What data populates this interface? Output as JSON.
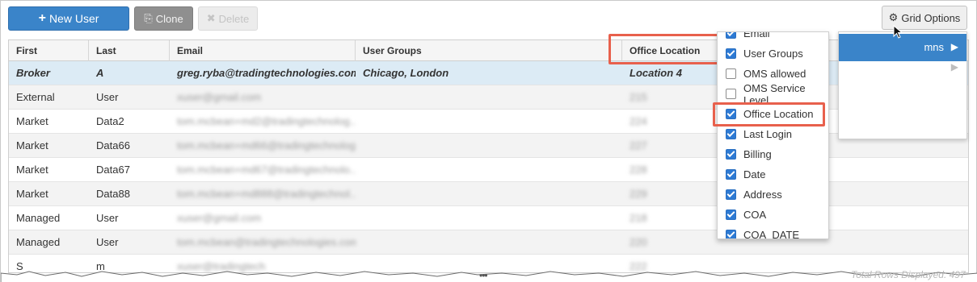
{
  "toolbar": {
    "new_user_icon": "+",
    "new_user_label": "New User",
    "clone_icon": "⎘",
    "clone_label": "Clone",
    "delete_icon": "✖",
    "delete_label": "Delete",
    "grid_options_icon": "⚙",
    "grid_options_label": "Grid Options"
  },
  "grid": {
    "columns": [
      "First",
      "Last",
      "Email",
      "User Groups",
      "Office Location"
    ],
    "rows": [
      {
        "first": "Broker",
        "last": "A",
        "email": "greg.ryba@tradingtechnologies.com",
        "groups": "Chicago, London",
        "location": "Location 4",
        "selected": true
      },
      {
        "first": "External",
        "last": "User",
        "email": "xuser@gmail.com",
        "groups": "",
        "location": "215"
      },
      {
        "first": "Market",
        "last": "Data2",
        "email": "tom.mcbean+md2@tradingtechnolog...",
        "groups": "",
        "location": "224"
      },
      {
        "first": "Market",
        "last": "Data66",
        "email": "tom.mcbean+md66@tradingtechnolog...",
        "groups": "",
        "location": "227"
      },
      {
        "first": "Market",
        "last": "Data67",
        "email": "tom.mcbean+md67@tradingtechnolo...",
        "groups": "",
        "location": "228"
      },
      {
        "first": "Market",
        "last": "Data88",
        "email": "tom.mcbean+md888@tradingtechnol...",
        "groups": "",
        "location": "229"
      },
      {
        "first": "Managed",
        "last": "User",
        "email": "xuser@gmail.com",
        "groups": "",
        "location": "218"
      },
      {
        "first": "Managed",
        "last": "User",
        "email": "tom.mcbean@tradingtechnologies.com",
        "groups": "",
        "location": "220"
      },
      {
        "first": "S",
        "last": "m",
        "email": "xuser@tradingtech",
        "groups": "",
        "location": "222"
      }
    ]
  },
  "menu": {
    "columns_label": "mns",
    "arrow": "▶"
  },
  "columns_menu": {
    "options": [
      {
        "label": "Email",
        "checked": true
      },
      {
        "label": "User Groups",
        "checked": true
      },
      {
        "label": "OMS allowed",
        "checked": false
      },
      {
        "label": "OMS Service Level",
        "checked": false
      },
      {
        "label": "Office Location",
        "checked": true
      },
      {
        "label": "Last Login",
        "checked": true
      },
      {
        "label": "Billing",
        "checked": true
      },
      {
        "label": "Date",
        "checked": true
      },
      {
        "label": "Address",
        "checked": true
      },
      {
        "label": "COA",
        "checked": true
      },
      {
        "label": "COA_DATE",
        "checked": true
      }
    ]
  },
  "footer": {
    "more_dots": "•••",
    "total_text": "Total Rows Displayed: 497"
  },
  "colors": {
    "primary": "#3a84c9",
    "selected_row": "#dcebf5",
    "highlight_box": "#e8604c",
    "checkbox": "#2d7ad4"
  }
}
